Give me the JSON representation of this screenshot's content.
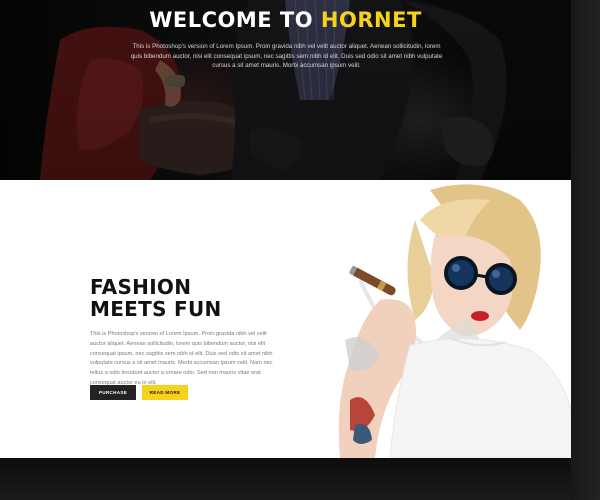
{
  "hero": {
    "title_prefix": "WELCOME TO ",
    "title_accent": "HORNET",
    "text": "This is Photoshop's version of Lorem Ipsum. Proin gravida nibh vel velit auctor aliquet. Aenean sollicitudin, lorem quis bibendum auctor, nisi elit consequat ipsum, nec sagittis sem nibh id elit. Duis sed odio sit amet nibh vulputate cursus a sit amet mauris. Morbi accumsan ipsum velit.",
    "accent_color": "#f7d21c"
  },
  "fashion": {
    "heading_line1": "FASHION",
    "heading_line2": "MEETS FUN",
    "text": "This is Photoshop's version of Lorem Ipsum. Proin gravida nibh vel velit auctor aliquet. Aenean sollicitudin, lorem quis bibendum auctor, nisi elit consequat ipsum, nec sagittis sem nibh id elit. Duis sed odio sit amet nibh vulputate cursus a sit amet mauris. Morbi accumsan ipsum velit. Nam nec tellus a odio tincidunt auctor a ornare odio. Sed non mauris vitae erat consequat auctor eu in elit.",
    "purchase_label": "PURCHASE",
    "read_more_label": "READ MORE"
  }
}
